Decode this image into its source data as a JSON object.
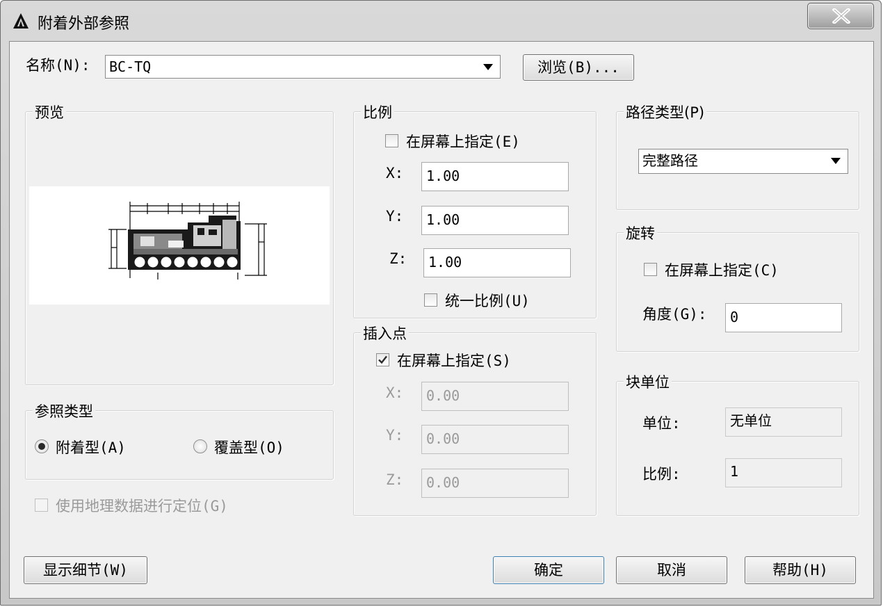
{
  "window": {
    "title": "附着外部参照",
    "close_label": "X"
  },
  "name_row": {
    "label": "名称(N):",
    "value": "BC-TQ",
    "browse_label": "浏览(B)..."
  },
  "preview": {
    "title": "预览"
  },
  "scale": {
    "title": "比例",
    "specify_label": "在屏幕上指定(E)",
    "specify_checked": false,
    "x_label": "X:",
    "x_value": "1.00",
    "y_label": "Y:",
    "y_value": "1.00",
    "z_label": "Z:",
    "z_value": "1.00",
    "uniform_label": "统一比例(U)",
    "uniform_checked": false
  },
  "path_type": {
    "title": "路径类型(P)",
    "value": "完整路径"
  },
  "rotation": {
    "title": "旋转",
    "specify_label": "在屏幕上指定(C)",
    "specify_checked": false,
    "angle_label": "角度(G):",
    "angle_value": "0"
  },
  "insertion_point": {
    "title": "插入点",
    "specify_label": "在屏幕上指定(S)",
    "specify_checked": true,
    "x_label": "X:",
    "x_value": "0.00",
    "y_label": "Y:",
    "y_value": "0.00",
    "z_label": "Z:",
    "z_value": "0.00"
  },
  "block_unit": {
    "title": "块单位",
    "unit_label": "单位:",
    "unit_value": "无单位",
    "factor_label": "比例:",
    "factor_value": "1"
  },
  "reference_type": {
    "title": "参照类型",
    "attach_label": "附着型(A)",
    "attach_selected": true,
    "overlay_label": "覆盖型(O)",
    "overlay_selected": false
  },
  "geo_label": "使用地理数据进行定位(G)",
  "buttons": {
    "details": "显示细节(W)",
    "ok": "确定",
    "cancel": "取消",
    "help": "帮助(H)"
  },
  "colors": {
    "dialog_bg": "#f0f0f0",
    "title_bar": "#d0d0d0",
    "disabled_text": "#9a9a9a"
  }
}
